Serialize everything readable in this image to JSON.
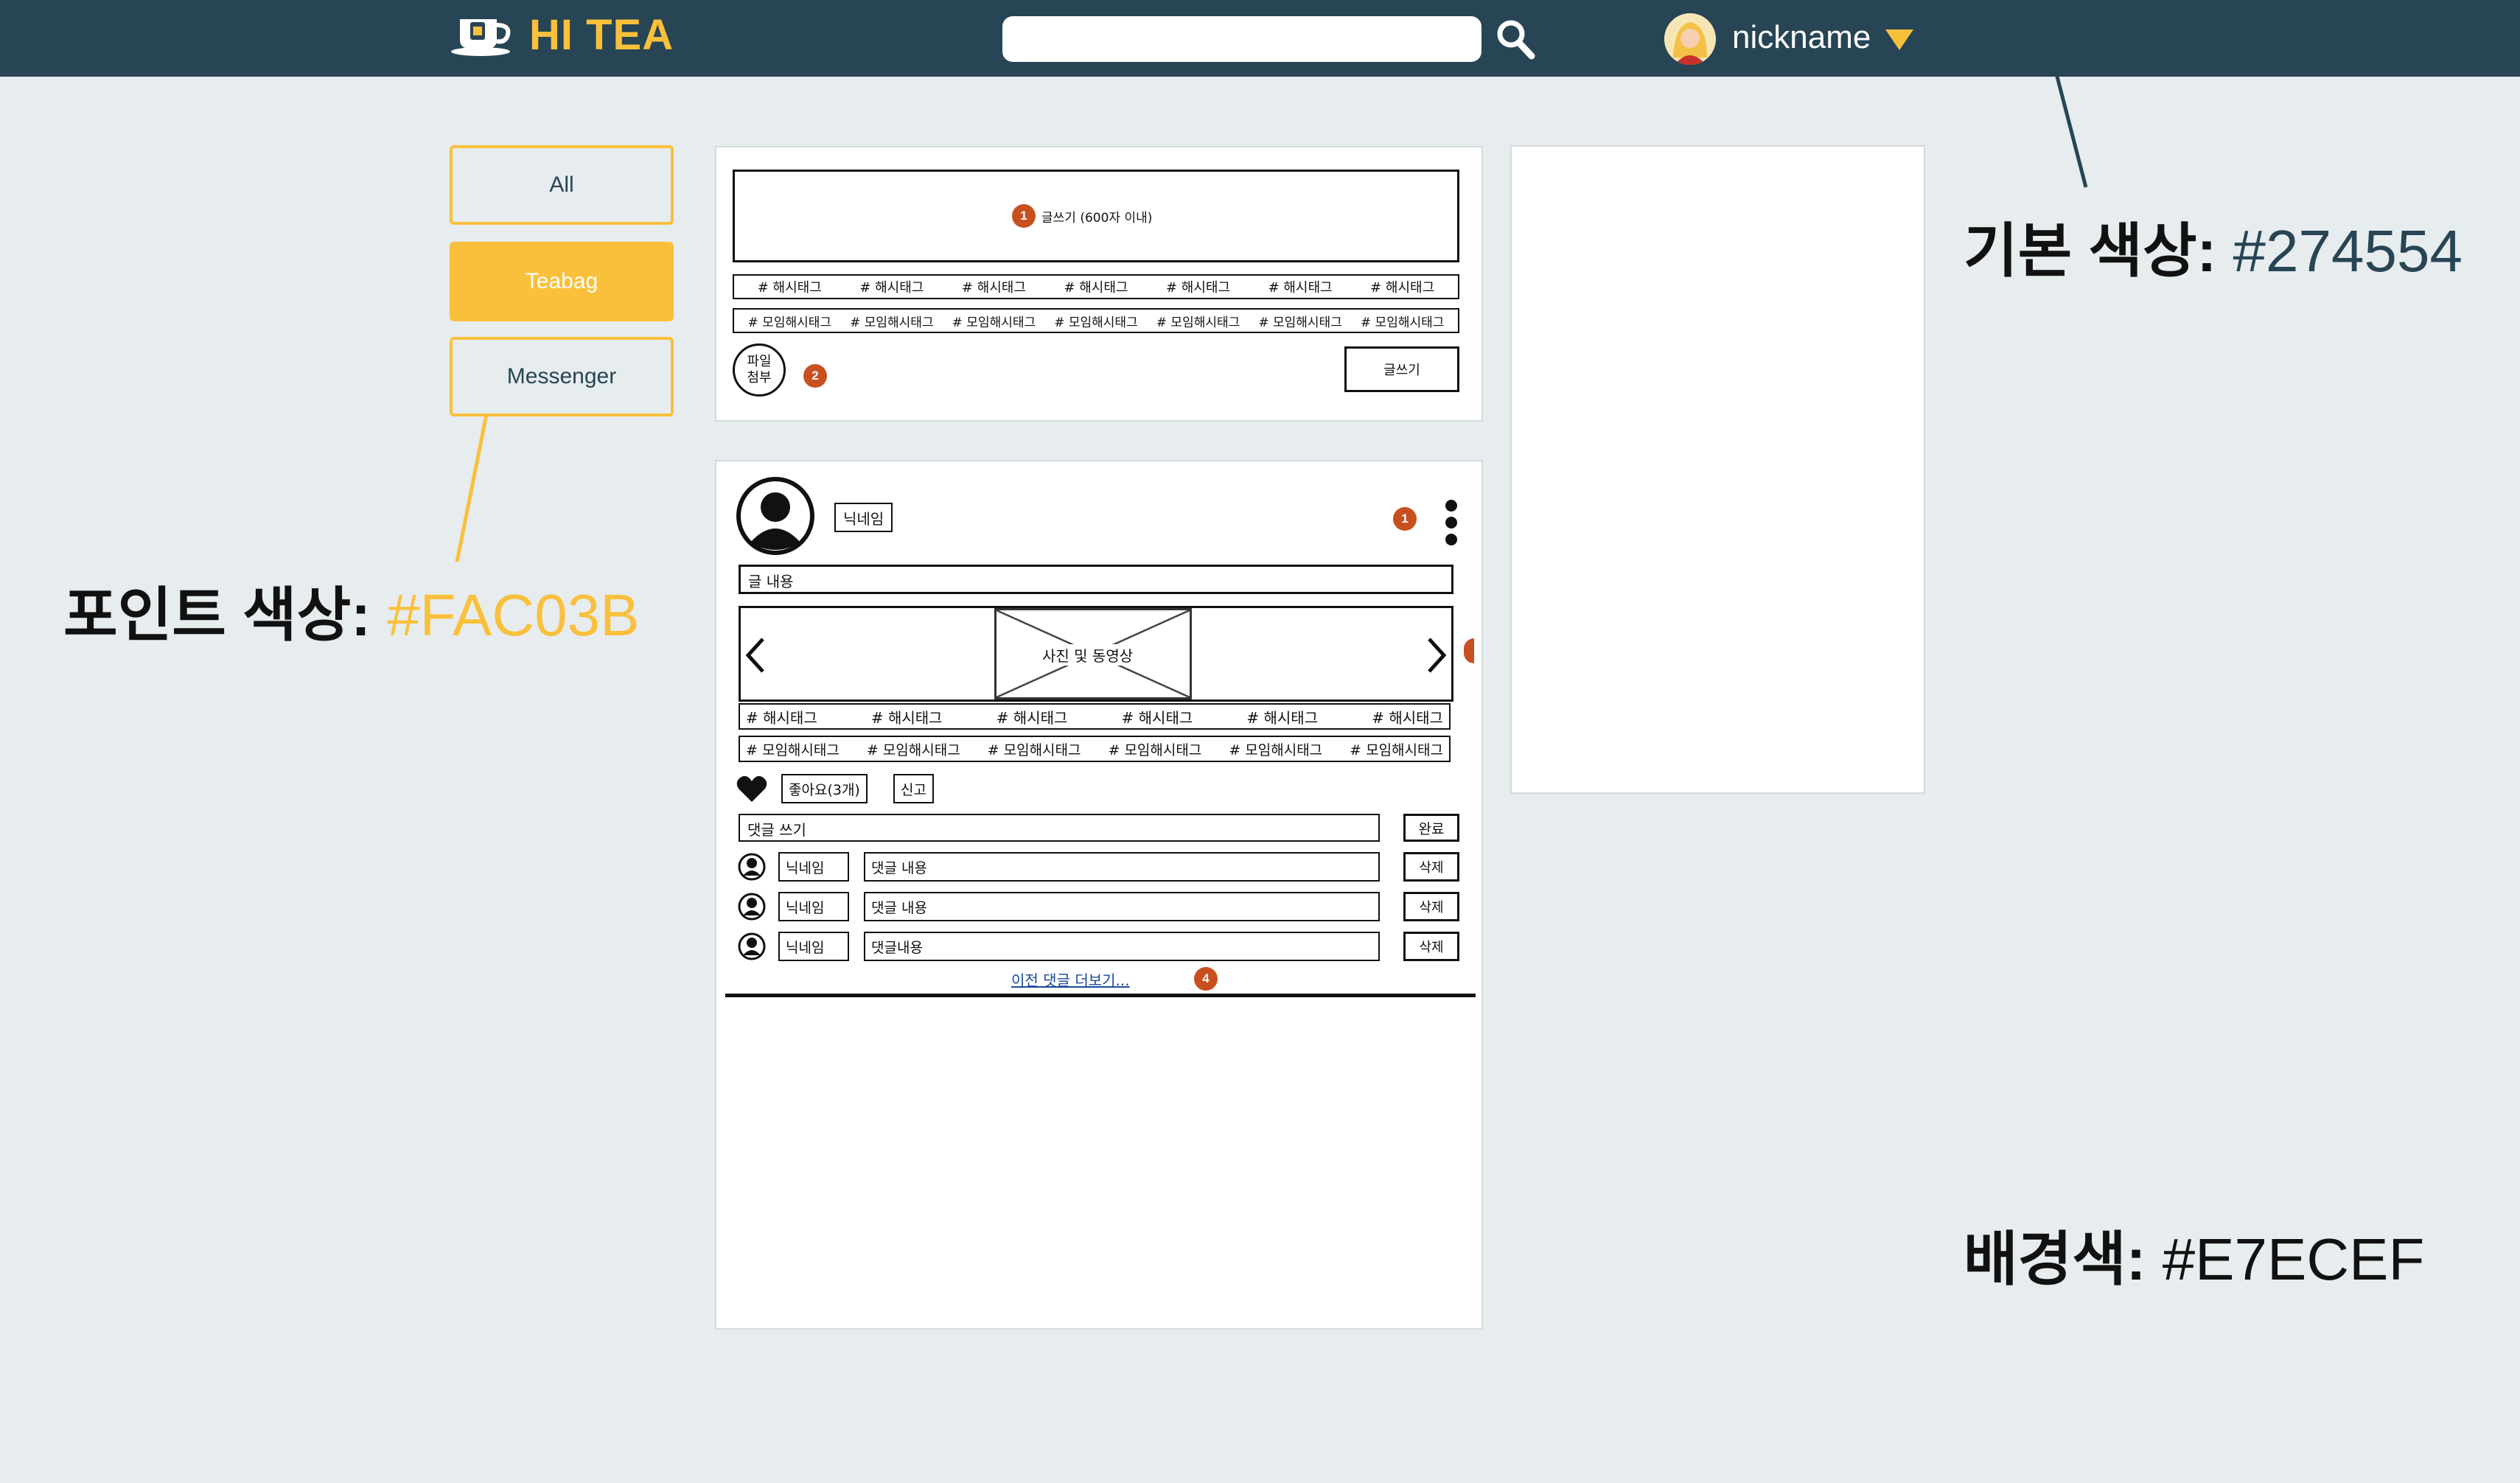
{
  "header": {
    "brand": "HI TEA",
    "search_value": "",
    "username": "nickname"
  },
  "sidebar": {
    "items": [
      {
        "label": "All"
      },
      {
        "label": "Teabag"
      },
      {
        "label": "Messenger"
      }
    ]
  },
  "composer": {
    "textarea_label": "글쓰기 (600자 이내)",
    "hashtags": [
      "# 해시태그",
      "# 해시태그",
      "# 해시태그",
      "# 해시태그",
      "# 해시태그",
      "# 해시태그",
      "# 해시태그"
    ],
    "group_hashtags": [
      "# 모임해시태그",
      "# 모임해시태그",
      "# 모임해시태그",
      "# 모임해시태그",
      "# 모임해시태그",
      "# 모임해시태그",
      "# 모임해시태그"
    ],
    "attach_label_1": "파일",
    "attach_label_2": "첨부",
    "submit_label": "글쓰기",
    "badge_1": "1",
    "badge_2": "2"
  },
  "post": {
    "author": "닉네임",
    "badge_1": "1",
    "content": "글 내용",
    "media_label": "사진 및 동영상",
    "hashtags": [
      "# 해시태그",
      "# 해시태그",
      "# 해시태그",
      "# 해시태그",
      "# 해시태그",
      "# 해시태그"
    ],
    "group_hashtags": [
      "# 모임해시태그",
      "# 모임해시태그",
      "# 모임해시태그",
      "# 모임해시태그",
      "# 모임해시태그",
      "# 모임해시태그"
    ],
    "like_label": "좋아요(3개)",
    "report_label": "신고",
    "comment_placeholder": "댓글 쓰기",
    "comment_submit": "완료",
    "comments": [
      {
        "author": "닉네임",
        "text": "댓글 내용",
        "delete": "삭제"
      },
      {
        "author": "닉네임",
        "text": "댓글 내용",
        "delete": "삭제"
      },
      {
        "author": "닉네임",
        "text": "댓글내용",
        "delete": "삭제"
      }
    ],
    "more_comments": "이전 댓글 더보기...",
    "badge_4": "4"
  },
  "annotations": {
    "primary_label": "기본 색상:",
    "primary_value": "#274554",
    "accent_label": "포인트 색상:",
    "accent_value": "#FAC03B",
    "bg_label": "배경색:",
    "bg_value": "#E7ECEF"
  },
  "colors": {
    "primary": "#274554",
    "accent": "#FAC03B",
    "background": "#E7ECEF",
    "badge": "#C8501E"
  }
}
